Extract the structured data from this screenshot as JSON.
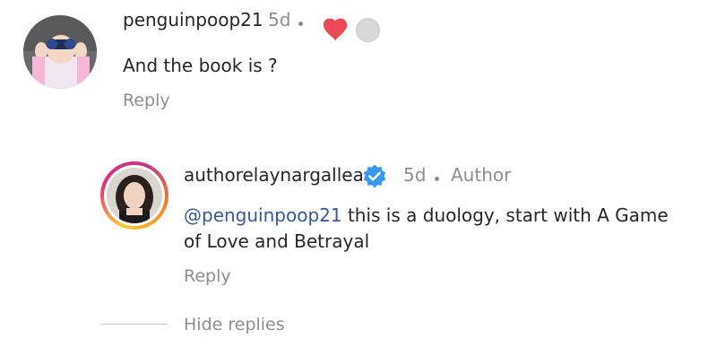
{
  "comments": [
    {
      "username": "penguinpoop21",
      "time": "5d",
      "text": "And the book is ?",
      "reply_label": "Reply"
    }
  ],
  "reply": {
    "username": "authorelaynargallea",
    "time": "5d",
    "badge_text": "Author",
    "mention": "@penguinpoop21",
    "text_line1": " this is a duology, start with A Game",
    "text_line2": "of Love and Betrayal",
    "reply_label": "Reply"
  },
  "thread": {
    "hide_replies_label": "Hide replies"
  },
  "colors": {
    "text": "#262626",
    "secondary": "#8e8e8e",
    "mention": "#385898",
    "like": "#ed4956",
    "verified": "#3897f0"
  },
  "icons": {
    "like": "heart-icon",
    "verified": "verified-badge-icon",
    "liker_avatar": "avatar"
  }
}
